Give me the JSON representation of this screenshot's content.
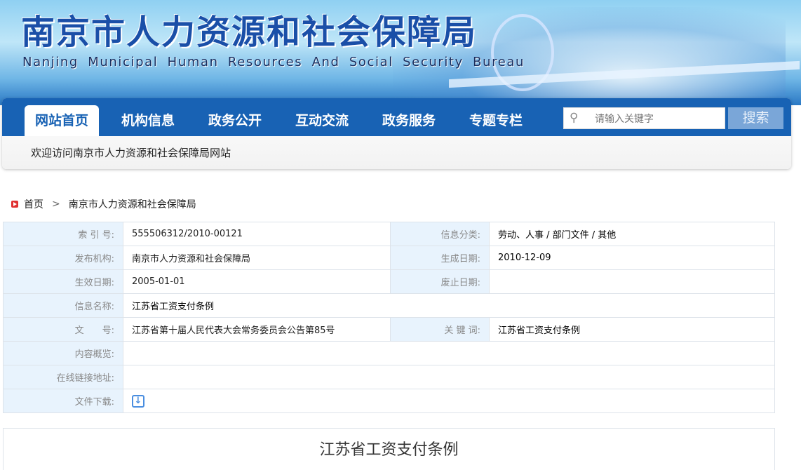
{
  "header": {
    "title_cn": "南京市人力资源和社会保障局",
    "title_en": "Nanjing Municipal Human Resources And Social Security Bureau"
  },
  "nav": {
    "items": [
      "网站首页",
      "机构信息",
      "政务公开",
      "互动交流",
      "政务服务",
      "专题专栏"
    ],
    "search_placeholder": "请输入关键字",
    "search_button": "搜索"
  },
  "welcome": "欢迎访问南京市人力资源和社会保障局网站",
  "breadcrumb": {
    "home": "首页",
    "sep": ">",
    "current": "南京市人力资源和社会保障局"
  },
  "info": {
    "index_label": "索 引 号:",
    "index": "555506312/2010-00121",
    "category_label": "信息分类:",
    "category": "劳动、人事 / 部门文件 / 其他",
    "publisher_label": "发布机构:",
    "publisher": "南京市人力资源和社会保障局",
    "created_label": "生成日期:",
    "created": "2010-12-09",
    "effective_label": "生效日期:",
    "effective": "2005-01-01",
    "abolished_label": "废止日期:",
    "abolished": "",
    "name_label": "信息名称:",
    "name": "江苏省工资支付条例",
    "docno_label": "文　　号:",
    "docno": "江苏省第十届人民代表大会常务委员会公告第85号",
    "keywords_label": "关 键 词:",
    "keywords": "江苏省工资支付条例",
    "summary_label": "内容概览:",
    "summary": "",
    "link_label": "在线链接地址:",
    "link": "",
    "download_label": "文件下载:"
  },
  "article": {
    "title": "江苏省工资支付条例"
  }
}
